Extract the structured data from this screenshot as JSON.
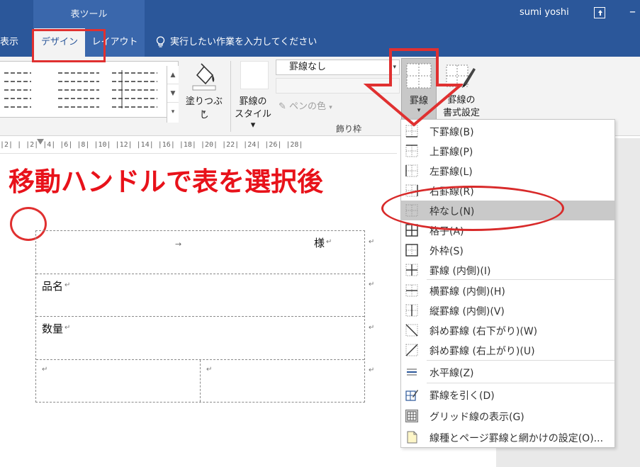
{
  "titlebar": {
    "context_tools": "表ツール",
    "user": "sumi yoshi"
  },
  "tabs": {
    "view": "表示",
    "design": "デザイン",
    "layout": "レイアウト",
    "tell_me": "実行したい作業を入力してください"
  },
  "ribbon": {
    "shading": "塗りつぶし",
    "border_styles_line1": "罫線の",
    "border_styles_line2": "スタイル",
    "line_style_value": "罫線なし",
    "pen_color": "ペンの色",
    "borders": "罫線",
    "painter_line1": "罫線の",
    "painter_line2": "書式設定",
    "group_label": "飾り枠"
  },
  "ruler": {
    "ticks": "|2|  |  |2|  |4|  |6|  |8| |10| |12| |14| |16| |18| |20| |22| |24| |26| |28|"
  },
  "document": {
    "annotation": "移動ハンドルで表を選択後",
    "cell_sama": "様",
    "cell_hinmei": "品名",
    "cell_suryo": "数量",
    "tab_mark": "→",
    "para": "↵"
  },
  "menu": {
    "items": [
      {
        "label": "下罫線(B)",
        "icon": "border-bottom-icon"
      },
      {
        "label": "上罫線(P)",
        "icon": "border-top-icon"
      },
      {
        "label": "左罫線(L)",
        "icon": "border-left-icon"
      },
      {
        "label": "右罫線(R)",
        "icon": "border-right-icon"
      },
      {
        "label": "枠なし(N)",
        "icon": "no-border-icon"
      },
      {
        "label": "格子(A)",
        "icon": "all-borders-icon"
      },
      {
        "label": "外枠(S)",
        "icon": "outside-borders-icon"
      },
      {
        "label": "罫線 (内側)(I)",
        "icon": "inside-borders-icon"
      },
      {
        "label": "横罫線 (内側)(H)",
        "icon": "inside-horizontal-icon"
      },
      {
        "label": "縦罫線 (内側)(V)",
        "icon": "inside-vertical-icon"
      },
      {
        "label": "斜め罫線 (右下がり)(W)",
        "icon": "diagonal-down-icon"
      },
      {
        "label": "斜め罫線 (右上がり)(U)",
        "icon": "diagonal-up-icon"
      },
      {
        "label": "水平線(Z)",
        "icon": "horizontal-line-icon"
      },
      {
        "label": "罫線を引く(D)",
        "icon": "draw-table-icon"
      },
      {
        "label": "グリッド線の表示(G)",
        "icon": "view-gridlines-icon"
      },
      {
        "label": "線種とページ罫線と網かけの設定(O)...",
        "icon": "borders-shading-icon"
      }
    ],
    "selected_index": 4
  },
  "colors": {
    "ribbon_blue": "#2b579a",
    "annotation_red": "#e8121a"
  }
}
